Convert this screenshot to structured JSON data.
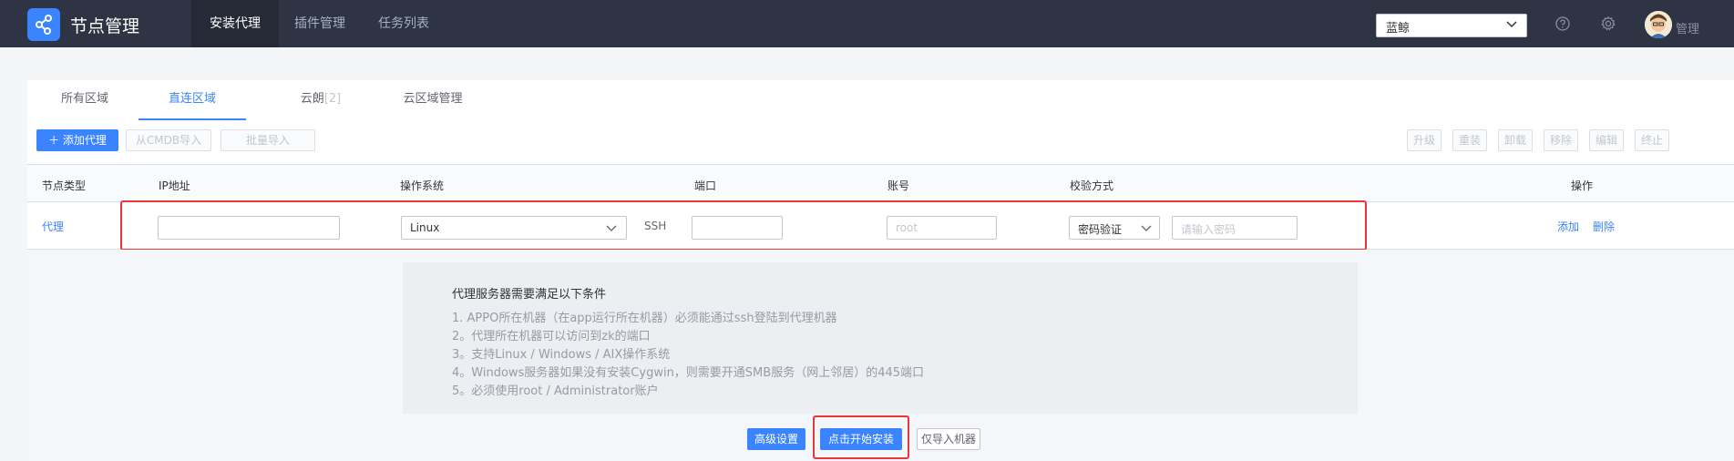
{
  "app": {
    "title": "节点管理"
  },
  "topnav": {
    "items": [
      "安装代理",
      "插件管理",
      "任务列表"
    ]
  },
  "biz": {
    "selected": "蓝鲸"
  },
  "user": {
    "name": "管理"
  },
  "tabs": {
    "all": "所有区域",
    "direct": "直连区域",
    "cloud": "云朗",
    "cloud_count": "[2]",
    "manage": "云区域管理"
  },
  "toolbar": {
    "add": "添加代理",
    "cmdb": "从CMDB导入",
    "batch": "批量导入",
    "upgrade": "升级",
    "reinstall": "重装",
    "uninstall": "卸载",
    "remove": "移除",
    "edit": "编辑",
    "stop": "终止"
  },
  "table": {
    "headers": {
      "type": "节点类型",
      "ip": "IP地址",
      "os": "操作系统",
      "port": "端口",
      "account": "账号",
      "auth": "校验方式",
      "ops": "操作"
    },
    "row": {
      "type": "代理",
      "ip": "",
      "os": "Linux",
      "port_label": "SSH",
      "port": "",
      "account_placeholder": "root",
      "auth": "密码验证",
      "password_placeholder": "请输入密码",
      "add": "添加",
      "delete": "删除"
    }
  },
  "tips": {
    "title": "代理服务器需要满足以下条件",
    "lines": [
      "1. APPO所在机器（在app运行所在机器）必须能通过ssh登陆到代理机器",
      "2。代理所在机器可以访问到zk的端口",
      "3。支持Linux / Windows / AIX操作系统",
      "4。Windows服务器如果没有安装Cygwin，则需要开通SMB服务（网上邻居）的445端口",
      "5。必须使用root / Administrator账户"
    ]
  },
  "footer": {
    "advanced": "高级设置",
    "install": "点击开始安装",
    "import_only": "仅导入机器"
  },
  "colors": {
    "primary": "#3a84ff",
    "topbar": "#2e3444",
    "highlight": "#ea3636"
  }
}
